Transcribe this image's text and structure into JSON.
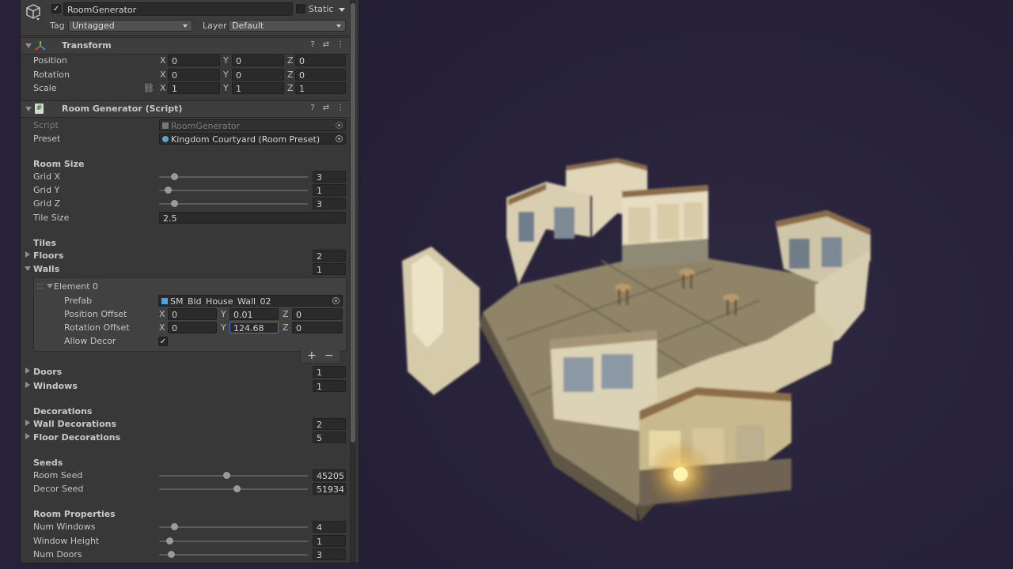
{
  "header": {
    "object_name": "RoomGenerator",
    "active": true,
    "static_label": "Static",
    "static": false,
    "tag_label": "Tag",
    "tag_value": "Untagged",
    "layer_label": "Layer",
    "layer_value": "Default"
  },
  "transform": {
    "title": "Transform",
    "position": {
      "label": "Position",
      "x": "0",
      "y": "0",
      "z": "0"
    },
    "rotation": {
      "label": "Rotation",
      "x": "0",
      "y": "0",
      "z": "0"
    },
    "scale": {
      "label": "Scale",
      "x": "1",
      "y": "1",
      "z": "1"
    }
  },
  "room_generator": {
    "title": "Room Generator (Script)",
    "script_label": "Script",
    "script_value": "RoomGenerator",
    "preset_label": "Preset",
    "preset_value": "Kingdom Courtyard (Room Preset)",
    "room_size": {
      "header": "Room Size",
      "grid_x": {
        "label": "Grid X",
        "value": "3",
        "fraction": 0.1
      },
      "grid_y": {
        "label": "Grid Y",
        "value": "1",
        "fraction": 0.06
      },
      "grid_z": {
        "label": "Grid Z",
        "value": "3",
        "fraction": 0.1
      },
      "tile_size": {
        "label": "Tile Size",
        "value": "2.5"
      }
    },
    "tiles": {
      "header": "Tiles",
      "floors": {
        "label": "Floors",
        "value": "2"
      },
      "walls": {
        "label": "Walls",
        "value": "1"
      },
      "element": {
        "label": "Element 0",
        "prefab_label": "Prefab",
        "prefab_value": "SM_Bld_House_Wall_02",
        "position_offset": {
          "label": "Position Offset",
          "x": "0",
          "y": "0.01",
          "z": "0"
        },
        "rotation_offset": {
          "label": "Rotation Offset",
          "x": "0",
          "y": "124.68",
          "z": "0"
        },
        "allow_decor_label": "Allow Decor",
        "allow_decor": true
      },
      "add_label": "+",
      "remove_label": "−",
      "doors": {
        "label": "Doors",
        "value": "1"
      },
      "windows": {
        "label": "Windows",
        "value": "1"
      }
    },
    "decorations": {
      "header": "Decorations",
      "wall_decorations": {
        "label": "Wall Decorations",
        "value": "2"
      },
      "floor_decorations": {
        "label": "Floor Decorations",
        "value": "5"
      }
    },
    "seeds": {
      "header": "Seeds",
      "room_seed": {
        "label": "Room Seed",
        "value": "45205",
        "fraction": 0.45
      },
      "decor_seed": {
        "label": "Decor Seed",
        "value": "51934",
        "fraction": 0.52
      }
    },
    "room_properties": {
      "header": "Room Properties",
      "num_windows": {
        "label": "Num Windows",
        "value": "4",
        "fraction": 0.1
      },
      "window_height": {
        "label": "Window Height",
        "value": "1",
        "fraction": 0.07
      },
      "num_doors": {
        "label": "Num Doors",
        "value": "3",
        "fraction": 0.08
      }
    }
  },
  "icons": [
    "cube-icon",
    "transform-icon",
    "script-icon",
    "help-icon",
    "settings-icon",
    "menu-icon",
    "link-icon",
    "prefab-icon",
    "preset-icon",
    "object-picker-icon"
  ],
  "colors": {
    "panel": "#383838",
    "field": "#2a2a2a",
    "scene": "#272239",
    "focus": "#3a79bb"
  }
}
